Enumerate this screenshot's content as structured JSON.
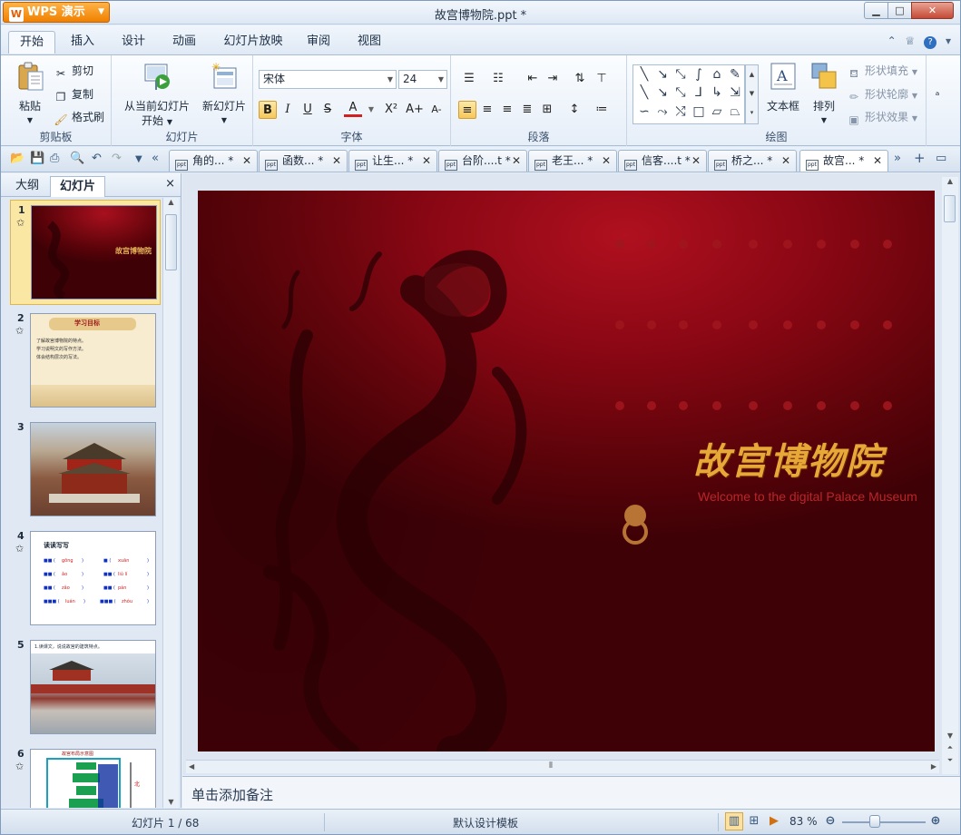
{
  "window": {
    "app_button": "WPS 演示",
    "title": "故宫博物院.ppt *",
    "min_icon": "minimize-icon",
    "max_icon": "maximize-icon",
    "close_icon": "close-icon"
  },
  "ribbon_tabs": [
    "开始",
    "插入",
    "设计",
    "动画",
    "幻灯片放映",
    "审阅",
    "视图"
  ],
  "active_ribbon_tab": "开始",
  "ribbon": {
    "clipboard": {
      "label": "剪贴板",
      "paste": "粘贴",
      "cut": "剪切",
      "copy": "复制",
      "format_painter": "格式刷"
    },
    "slides": {
      "label": "幻灯片",
      "from_current_line1": "从当前幻灯片",
      "from_current_line2": "开始",
      "new_slide": "新幻灯片"
    },
    "font": {
      "label": "字体",
      "font_name": "宋体",
      "font_size": "24",
      "bold": "B",
      "italic": "I",
      "underline": "U",
      "strike": "S",
      "font_color": "A",
      "superscript": "X²",
      "grow": "A+",
      "shrink": "A-"
    },
    "paragraph": {
      "label": "段落"
    },
    "drawing": {
      "label": "绘图",
      "textbox": "文本框",
      "arrange": "排列",
      "shape_fill": "形状填充",
      "shape_outline": "形状轮廓",
      "shape_effect": "形状效果"
    }
  },
  "doc_tabs": [
    {
      "label": "角的... *"
    },
    {
      "label": "函数... *"
    },
    {
      "label": "让生... *"
    },
    {
      "label": "台阶....t *"
    },
    {
      "label": "老王... *"
    },
    {
      "label": "信客....t *"
    },
    {
      "label": "桥之... *"
    },
    {
      "label": "故宫... *"
    }
  ],
  "nav": {
    "tab_outline": "大纲",
    "tab_slides": "幻灯片",
    "close": "×",
    "thumbs": [
      {
        "num": "1",
        "title": "故宫博物院"
      },
      {
        "num": "2",
        "title": "学习目标",
        "lines": [
          "了解故宫博物院的特点。",
          "学习说明文的写作方法。",
          "体会结构层次的写法。"
        ]
      },
      {
        "num": "3"
      },
      {
        "num": "4",
        "title": "读读写写"
      },
      {
        "num": "5",
        "title": "1.读课文，说说故宫的建筑特点。"
      },
      {
        "num": "6",
        "title": "故宫布局示意图"
      }
    ]
  },
  "slide": {
    "title_cn": "故宫博物院",
    "subtitle_en": "Welcome to the digital Palace Museum"
  },
  "notes_placeholder": "单击添加备注",
  "status": {
    "slide_counter": "幻灯片 1 / 68",
    "template": "默认设计模板",
    "zoom": "83 %",
    "zoom_value": 83
  }
}
